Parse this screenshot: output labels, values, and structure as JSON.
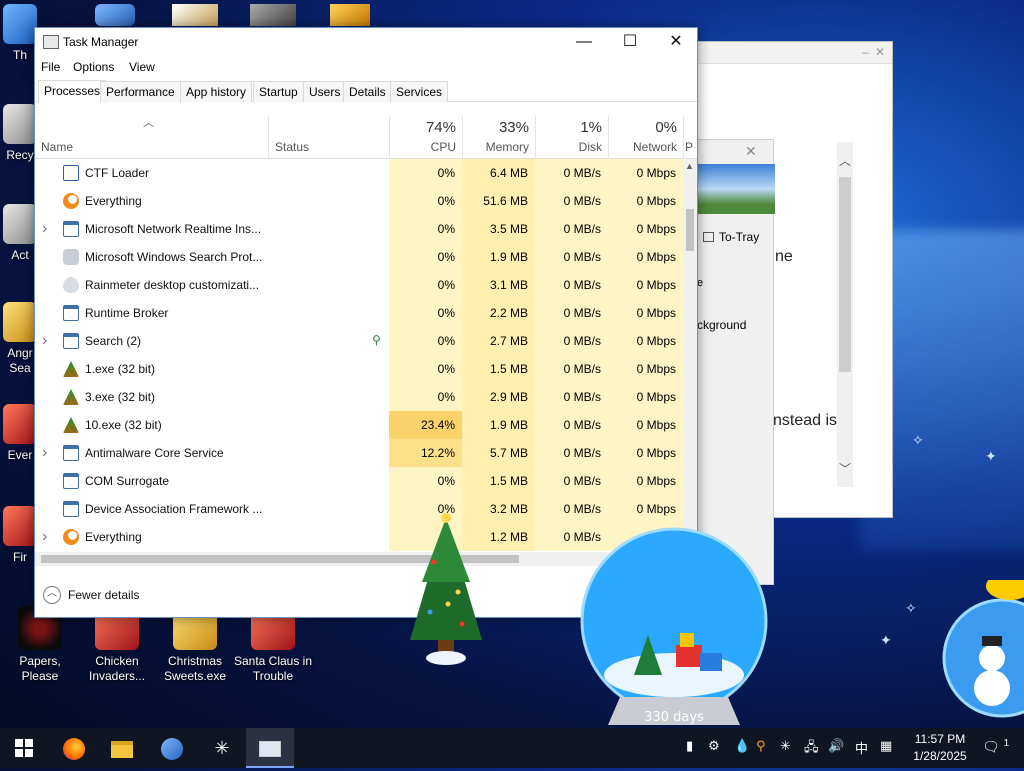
{
  "desktop": {
    "icons": [
      {
        "label": "Papers, Please"
      },
      {
        "label": "Chicken Invaders..."
      },
      {
        "label": "Christmas Sweets.exe"
      },
      {
        "label": "Santa Claus in Trouble"
      },
      {
        "label": "Th"
      },
      {
        "label": "Recy"
      },
      {
        "label": "Act"
      },
      {
        "label": "Angr Sea"
      },
      {
        "label": "Ever"
      },
      {
        "label": "Fir"
      }
    ]
  },
  "background_window": {
    "to_tray_label": "To-Tray",
    "text_ne": "ne",
    "text_e": "e",
    "text_background": "ckground",
    "text_instead": "nstead is"
  },
  "task_manager": {
    "title": "Task Manager",
    "menu": [
      "File",
      "Options",
      "View"
    ],
    "tabs": [
      "Processes",
      "Performance",
      "App history",
      "Startup",
      "Users",
      "Details",
      "Services"
    ],
    "active_tab": "Processes",
    "columns": {
      "name": "Name",
      "status": "Status",
      "cpu": {
        "pct": "74%",
        "label": "CPU"
      },
      "memory": {
        "pct": "33%",
        "label": "Memory"
      },
      "disk": {
        "pct": "1%",
        "label": "Disk"
      },
      "network": {
        "pct": "0%",
        "label": "Network"
      },
      "extra": "P"
    },
    "processes": [
      {
        "name": "CTF Loader",
        "expandable": false,
        "cpu": "0%",
        "memory": "6.4 MB",
        "disk": "0 MB/s",
        "network": "0 Mbps",
        "icon": "ctf-icon"
      },
      {
        "name": "Everything",
        "expandable": false,
        "cpu": "0%",
        "memory": "51.6 MB",
        "disk": "0 MB/s",
        "network": "0 Mbps",
        "icon": "search-magnifier-icon"
      },
      {
        "name": "Microsoft Network Realtime Ins...",
        "expandable": true,
        "cpu": "0%",
        "memory": "3.5 MB",
        "disk": "0 MB/s",
        "network": "0 Mbps",
        "icon": "window-icon"
      },
      {
        "name": "Microsoft Windows Search Prot...",
        "expandable": false,
        "cpu": "0%",
        "memory": "1.9 MB",
        "disk": "0 MB/s",
        "network": "0 Mbps",
        "icon": "search-protocol-icon"
      },
      {
        "name": "Rainmeter desktop customizati...",
        "expandable": false,
        "cpu": "0%",
        "memory": "3.1 MB",
        "disk": "0 MB/s",
        "network": "0 Mbps",
        "icon": "rainmeter-drop-icon"
      },
      {
        "name": "Runtime Broker",
        "expandable": false,
        "cpu": "0%",
        "memory": "2.2 MB",
        "disk": "0 MB/s",
        "network": "0 Mbps",
        "icon": "window-icon"
      },
      {
        "name": "Search (2)",
        "expandable": true,
        "cpu": "0%",
        "memory": "2.7 MB",
        "disk": "0 MB/s",
        "network": "0 Mbps",
        "icon": "window-icon",
        "suspended": true
      },
      {
        "name": "1.exe (32 bit)",
        "expandable": false,
        "cpu": "0%",
        "memory": "1.5 MB",
        "disk": "0 MB/s",
        "network": "0 Mbps",
        "icon": "tree-icon"
      },
      {
        "name": "3.exe (32 bit)",
        "expandable": false,
        "cpu": "0%",
        "memory": "2.9 MB",
        "disk": "0 MB/s",
        "network": "0 Mbps",
        "icon": "tree-icon"
      },
      {
        "name": "10.exe (32 bit)",
        "expandable": false,
        "cpu": "23.4%",
        "memory": "1.9 MB",
        "disk": "0 MB/s",
        "network": "0 Mbps",
        "icon": "tree-icon"
      },
      {
        "name": "Antimalware Core Service",
        "expandable": true,
        "cpu": "12.2%",
        "memory": "5.7 MB",
        "disk": "0 MB/s",
        "network": "0 Mbps",
        "icon": "window-icon"
      },
      {
        "name": "COM Surrogate",
        "expandable": false,
        "cpu": "0%",
        "memory": "1.5 MB",
        "disk": "0 MB/s",
        "network": "0 Mbps",
        "icon": "window-icon"
      },
      {
        "name": "Device Association Framework ...",
        "expandable": false,
        "cpu": "0%",
        "memory": "3.2 MB",
        "disk": "0 MB/s",
        "network": "0 Mbps",
        "icon": "window-icon"
      },
      {
        "name": "Everything",
        "expandable": true,
        "cpu": "",
        "memory": "1.2 MB",
        "disk": "0 MB/s",
        "network": "",
        "icon": "search-magnifier-icon"
      }
    ],
    "fewer_details": "Fewer details"
  },
  "decorations": {
    "globe_text": "330 days"
  },
  "taskbar": {
    "clock_time": "11:57 PM",
    "clock_date": "1/28/2025",
    "ime": "中",
    "notification_count": "1"
  }
}
